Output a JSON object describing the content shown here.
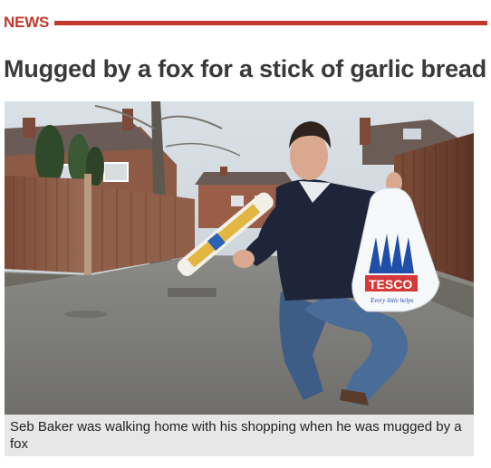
{
  "section": {
    "label": "NEWS",
    "color": "#c0392b"
  },
  "article": {
    "headline": "Mugged by a fox for a stick of garlic bread",
    "caption": "Seb Baker was walking home with his shopping when he was mugged by a fox"
  },
  "photo": {
    "bag_brand": "TESCO",
    "bag_tagline": "Every little helps"
  }
}
